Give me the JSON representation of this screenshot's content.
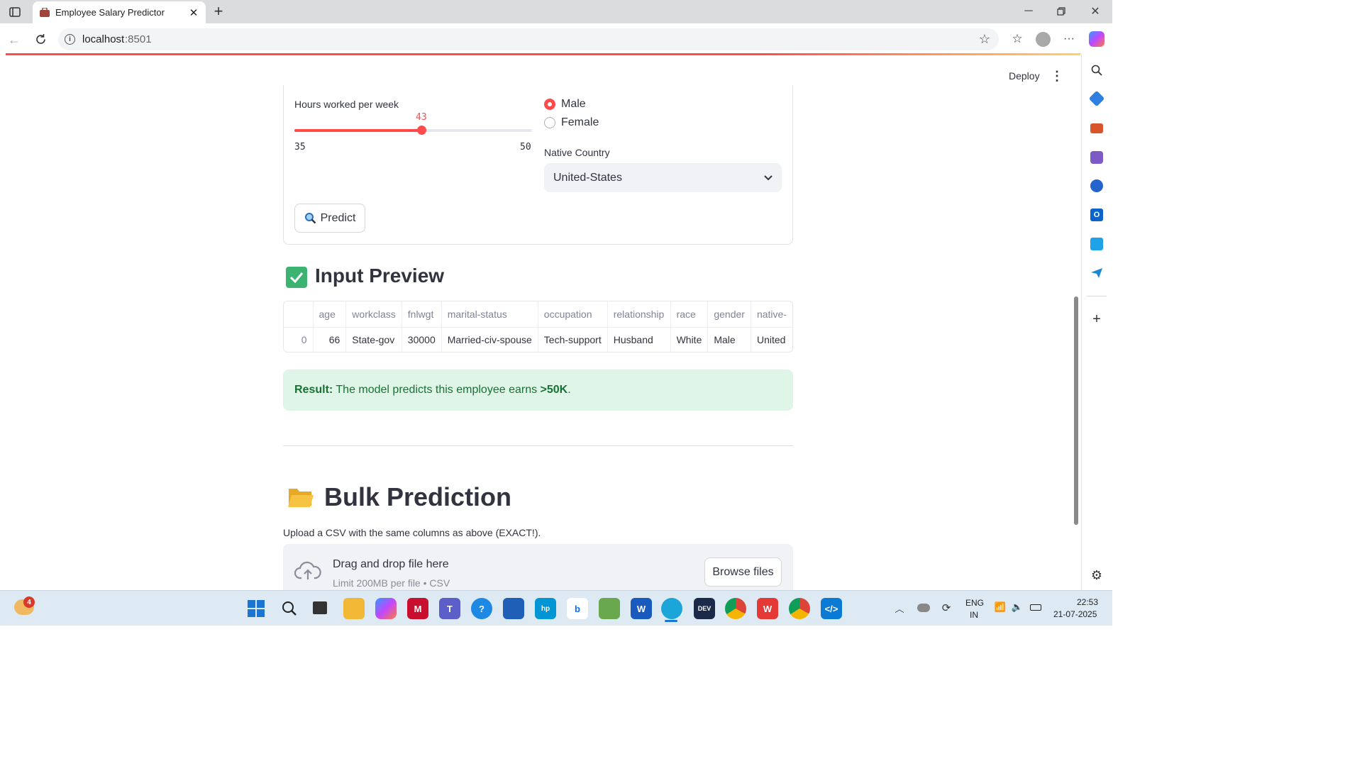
{
  "browser": {
    "tab_title": "Employee Salary Predictor",
    "url_host": "localhost",
    "url_port": ":8501"
  },
  "header": {
    "deploy_label": "Deploy"
  },
  "form": {
    "hours_label": "Hours worked per week",
    "hours_value": "43",
    "hours_min": "35",
    "hours_max": "50",
    "hours_fraction": 0.533,
    "gender_options": [
      "Male",
      "Female"
    ],
    "gender_selected": "Male",
    "country_label": "Native Country",
    "country_value": "United-States",
    "predict_label": "Predict"
  },
  "preview": {
    "heading": "Input Preview",
    "columns": [
      "",
      "age",
      "workclass",
      "fnlwgt",
      "marital-status",
      "occupation",
      "relationship",
      "race",
      "gender",
      "native-"
    ],
    "row": [
      "0",
      "66",
      "State-gov",
      "30000",
      "Married-civ-spouse",
      "Tech-support",
      "Husband",
      "White",
      "Male",
      "United"
    ]
  },
  "result": {
    "prefix": "Result:",
    "text": " The model predicts this employee earns ",
    "value": ">50K",
    "suffix": "."
  },
  "bulk": {
    "heading": "Bulk Prediction",
    "instruction": "Upload a CSV with the same columns as above (EXACT!).",
    "drop_title": "Drag and drop file here",
    "drop_limit": "Limit 200MB per file • CSV",
    "browse_label": "Browse files"
  },
  "taskbar": {
    "weather_badge": "4",
    "lang_line1": "ENG",
    "lang_line2": "IN",
    "time": "22:53",
    "date": "21-07-2025"
  },
  "colors": {
    "accent": "#ff4b4b",
    "success_bg": "#dff5e7",
    "success_text": "#177233"
  }
}
